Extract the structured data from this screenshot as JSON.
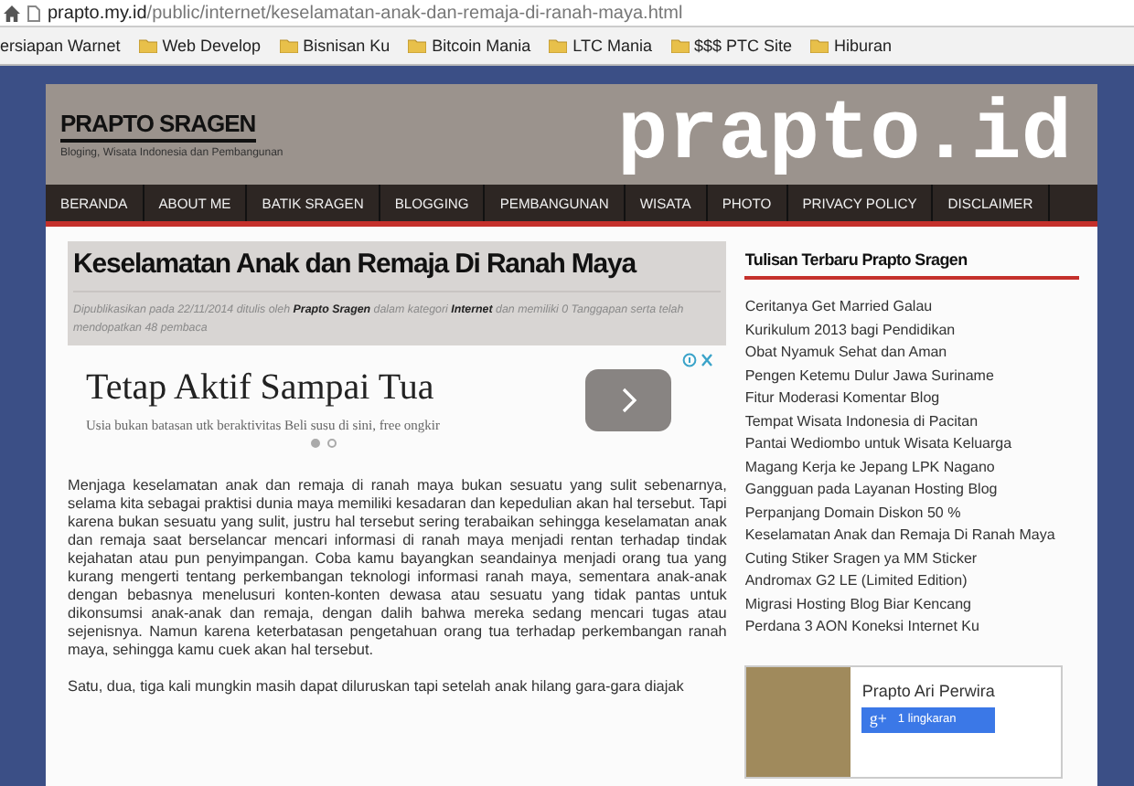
{
  "browser": {
    "url_host": "prapto.my.id",
    "url_path": "/public/internet/keselamatan-anak-dan-remaja-di-ranah-maya.html",
    "bookmarks": [
      {
        "label": "ersiapan Warnet",
        "kind": "cut"
      },
      {
        "label": "Web Develop",
        "kind": "folder"
      },
      {
        "label": "Bisnisan Ku",
        "kind": "folder"
      },
      {
        "label": "Bitcoin Mania",
        "kind": "folder"
      },
      {
        "label": "LTC Mania",
        "kind": "folder"
      },
      {
        "label": "$$$ PTC Site",
        "kind": "folder"
      },
      {
        "label": "Hiburan",
        "kind": "folder"
      }
    ]
  },
  "header": {
    "site_title": "PRAPTO SRAGEN",
    "tagline": "Bloging, Wisata Indonesia dan Pembangunan",
    "logo": "prapto.id"
  },
  "nav": [
    "BERANDA",
    "ABOUT ME",
    "BATIK SRAGEN",
    "BLOGGING",
    "PEMBANGUNAN",
    "WISATA",
    "PHOTO",
    "PRIVACY POLICY",
    "DISCLAIMER"
  ],
  "article": {
    "title": "Keselamatan Anak dan Remaja Di Ranah Maya",
    "meta": "Dipublikasikan pada 22/11/2014 ditulis oleh **Prapto Sragen** dalam kategori **Internet** dan memiliki 0 Tanggapan serta telah mendopatkan 48 pembaca",
    "ad": {
      "headline": "Tetap Aktif Sampai Tua",
      "text": "Usia bukan batasan utk beraktivitas Beli susu di sini, free ongkir",
      "dots": [
        {
          "selected": true
        },
        {
          "selected": false
        }
      ]
    },
    "paragraphs": [
      "Menjaga keselamatan anak dan remaja di ranah maya bukan sesuatu yang sulit sebenarnya, selama kita sebagai praktisi dunia maya memiliki kesadaran dan kepedulian akan hal tersebut. Tapi karena bukan sesuatu yang sulit, justru hal tersebut sering terabaikan sehingga keselamatan anak dan remaja saat berselancar mencari informasi di ranah maya menjadi rentan terhadap tindak kejahatan atau pun penyimpangan. Coba kamu bayangkan seandainya menjadi orang tua yang kurang mengerti tentang perkembangan teknologi informasi ranah maya, sementara anak-anak dengan bebasnya menelusuri konten-konten dewasa atau sesuatu yang tidak pantas untuk dikonsumsi anak-anak dan remaja, dengan dalih bahwa mereka sedang mencari tugas atau sejenisnya. Namun karena keterbatasan pengetahuan orang tua terhadap perkembangan ranah maya, sehingga kamu cuek akan hal tersebut.",
      "Satu, dua, tiga kali mungkin masih dapat diluruskan tapi setelah anak hilang gara-gara diajak"
    ]
  },
  "sidebar": {
    "heading": "Tulisan Terbaru Prapto Sragen",
    "posts": [
      "Ceritanya Get Married Galau",
      "Kurikulum 2013 bagi Pendidikan",
      "Obat Nyamuk Sehat dan Aman",
      "Pengen Ketemu Dulur Jawa Suriname",
      "Fitur Moderasi Komentar Blog",
      "Tempat Wisata Indonesia di Pacitan",
      "Pantai Wediombo untuk Wisata Keluarga",
      "Magang Kerja ke Jepang LPK Nagano",
      "Gangguan pada Layanan Hosting Blog",
      "Perpanjang Domain Diskon 50 %",
      "Keselamatan Anak dan Remaja Di Ranah Maya",
      "Cuting Stiker Sragen ya MM Sticker",
      "Andromax G2 LE (Limited Edition)",
      "Migrasi Hosting Blog Biar Kencang",
      "Perdana 3 AON Koneksi Internet Ku"
    ],
    "profile": {
      "name": "Prapto Ari Perwira",
      "badge": "g+",
      "button": "1 lingkaran"
    }
  }
}
